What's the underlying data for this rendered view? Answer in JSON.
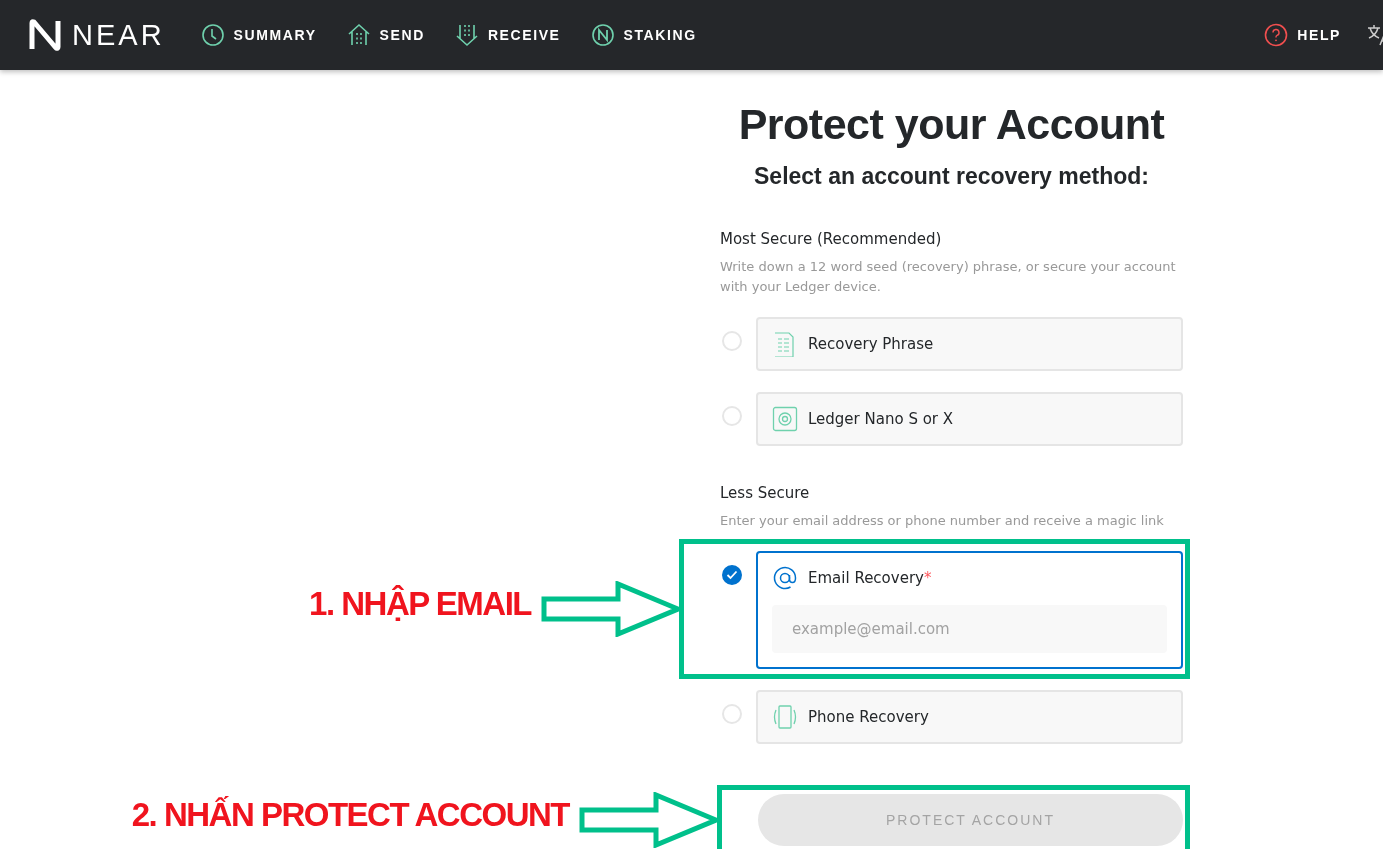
{
  "nav": {
    "logo": "NEAR",
    "items": [
      {
        "label": "SUMMARY",
        "kind": "clock"
      },
      {
        "label": "SEND",
        "kind": "send"
      },
      {
        "label": "RECEIVE",
        "kind": "receive"
      },
      {
        "label": "STAKING",
        "kind": "staking"
      }
    ],
    "help": "HELP"
  },
  "title": "Protect your Account",
  "subtitle": "Select an account recovery method:",
  "sections": [
    {
      "heading": "Most Secure (Recommended)",
      "description": "Write down a 12 word seed (recovery) phrase, or secure your account with your Ledger device.",
      "options": [
        {
          "kind": "phrase",
          "label": "Recovery Phrase",
          "selected": false
        },
        {
          "kind": "ledger",
          "label": "Ledger Nano S or X",
          "selected": false
        }
      ]
    },
    {
      "heading": "Less Secure",
      "description": "Enter your email address or phone number and receive a magic link",
      "options": [
        {
          "kind": "email",
          "label": "Email Recovery",
          "required_mark": "*",
          "placeholder": "example@email.com",
          "selected": true
        },
        {
          "kind": "phone",
          "label": "Phone Recovery",
          "selected": false
        }
      ]
    }
  ],
  "button": {
    "label": "PROTECT ACCOUNT",
    "disabled": true
  },
  "annotations": [
    {
      "text": "1. NHẬP EMAIL",
      "kind": "field"
    },
    {
      "text": "2. NHẤN PROTECT ACCOUNT",
      "kind": "button"
    }
  ]
}
